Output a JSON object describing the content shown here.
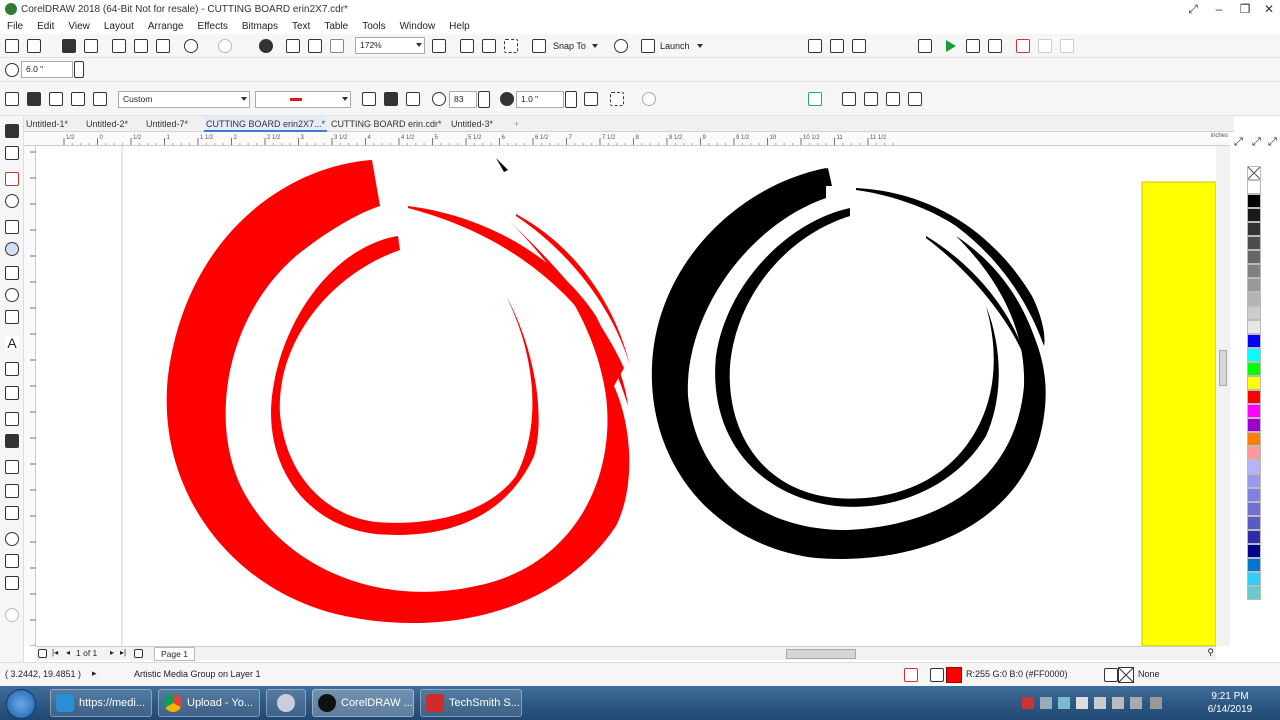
{
  "app": {
    "title": "CorelDRAW 2018 (64-Bit Not for resale) - CUTTING BOARD erin2X7.cdr*"
  },
  "menu": [
    "File",
    "Edit",
    "View",
    "Layout",
    "Arrange",
    "Effects",
    "Bitmaps",
    "Text",
    "Table",
    "Tools",
    "Window",
    "Help"
  ],
  "standard_toolbar": {
    "zoom_value": "172%",
    "snap_to_label": "Snap To",
    "launch_label": "Launch"
  },
  "property_bar": {
    "nudge_value": "6.0 \"",
    "preset_value": "Custom",
    "smoothing_value": "83",
    "stroke_width_value": "1.0 \""
  },
  "doc_tabs": [
    "Untitled-1*",
    "Untitled-2*",
    "Untitled-7*",
    "CUTTING BOARD erin2X7...*",
    "CUTTING BOARD erin.cdr*",
    "Untitled-3*"
  ],
  "ruler": {
    "unit_label": "inches",
    "ticks": [
      "1/2",
      "0",
      "1/2",
      "1",
      "1 1/2",
      "2",
      "2 1/2",
      "3",
      "3 1/2",
      "4",
      "4 1/2",
      "5",
      "5 1/2",
      "6",
      "6 1/2",
      "7",
      "7 1/2",
      "8",
      "8 1/2",
      "9",
      "9 1/2",
      "10",
      "10 1/2",
      "11",
      "11 1/2"
    ]
  },
  "page_nav": {
    "page_indicator": "1 of 1",
    "page_tab": "Page 1"
  },
  "status": {
    "coordinates": "( 3.2442, 19.4851 )",
    "selection_info": "Artistic Media Group on Layer 1",
    "fill_info": "R:255 G:0 B:0 (#FF0000)",
    "outline_info": "None"
  },
  "colors": {
    "fill_red": "#ff0000",
    "black": "#000000",
    "yellow": "#ffff00",
    "palette": [
      "#ffffff",
      "#000000",
      "#1a1a1a",
      "#333333",
      "#4d4d4d",
      "#666666",
      "#808080",
      "#999999",
      "#b3b3b3",
      "#cccccc",
      "#e6e6e6",
      "#0000ff",
      "#00ffff",
      "#00ff00",
      "#ffff00",
      "#ff0000",
      "#ff00ff",
      "#9b00cc",
      "#ff7f00",
      "#ff9999",
      "#b3b3ff",
      "#9999ee",
      "#8080e0",
      "#6f6fd6",
      "#5a5ac4",
      "#2d2da8",
      "#00008b",
      "#0077cc",
      "#33ccff",
      "#66cccc"
    ]
  },
  "taskbar": {
    "items": [
      "https://medi...",
      "Upload - Yo...",
      "",
      "CorelDRAW ...",
      "TechSmith S..."
    ],
    "clock_time": "9:21 PM",
    "clock_date": "6/14/2019"
  }
}
